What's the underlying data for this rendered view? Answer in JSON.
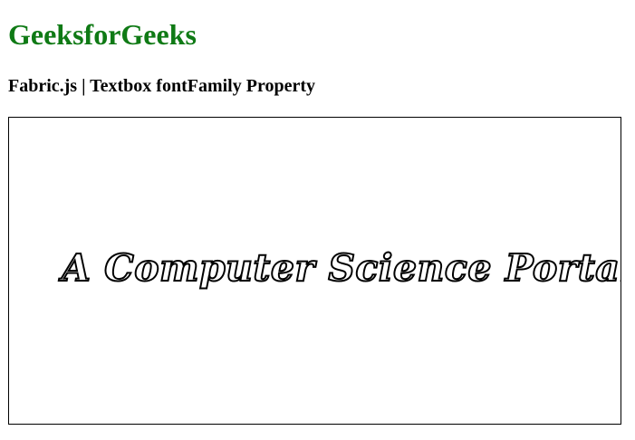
{
  "header": {
    "title": "GeeksforGeeks",
    "subtitle": "Fabric.js | Textbox fontFamily Property"
  },
  "canvas": {
    "textbox_text": "A Computer Science Portal"
  },
  "colors": {
    "title": "#0f7a15",
    "text_stroke": "#000000",
    "text_fill": "#ffffff",
    "canvas_border": "#000000"
  }
}
